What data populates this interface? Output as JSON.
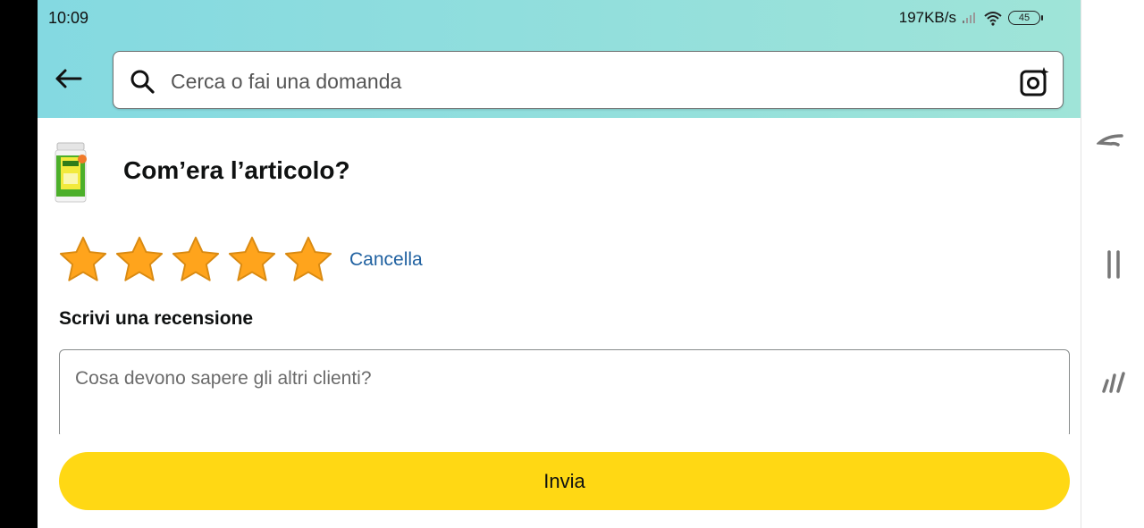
{
  "status_bar": {
    "time": "10:09",
    "network_speed": "197KB/s",
    "battery": "45",
    "icons": [
      "signal-icon",
      "wifi-icon",
      "battery-icon"
    ]
  },
  "header": {
    "back_icon": "back-arrow-icon",
    "search_placeholder": "Cerca o fai una domanda",
    "camera_icon": "camera-search-icon",
    "gradient": [
      "#84d9e1",
      "#9fe4d8"
    ]
  },
  "review": {
    "title": "Com’era l’articolo?",
    "rating": 5,
    "rating_max": 5,
    "clear_label": "Cancella",
    "write_label": "Scrivi una recensione",
    "text_placeholder": "Cosa devono sapere gli altri clienti?",
    "submit_label": "Invia"
  },
  "colors": {
    "star": "#ffa41c",
    "link": "#2162a1",
    "button": "#ffd814"
  },
  "side_nav": {
    "icons": [
      "back-gesture-icon",
      "pause-icon",
      "slash-lines-icon"
    ]
  }
}
